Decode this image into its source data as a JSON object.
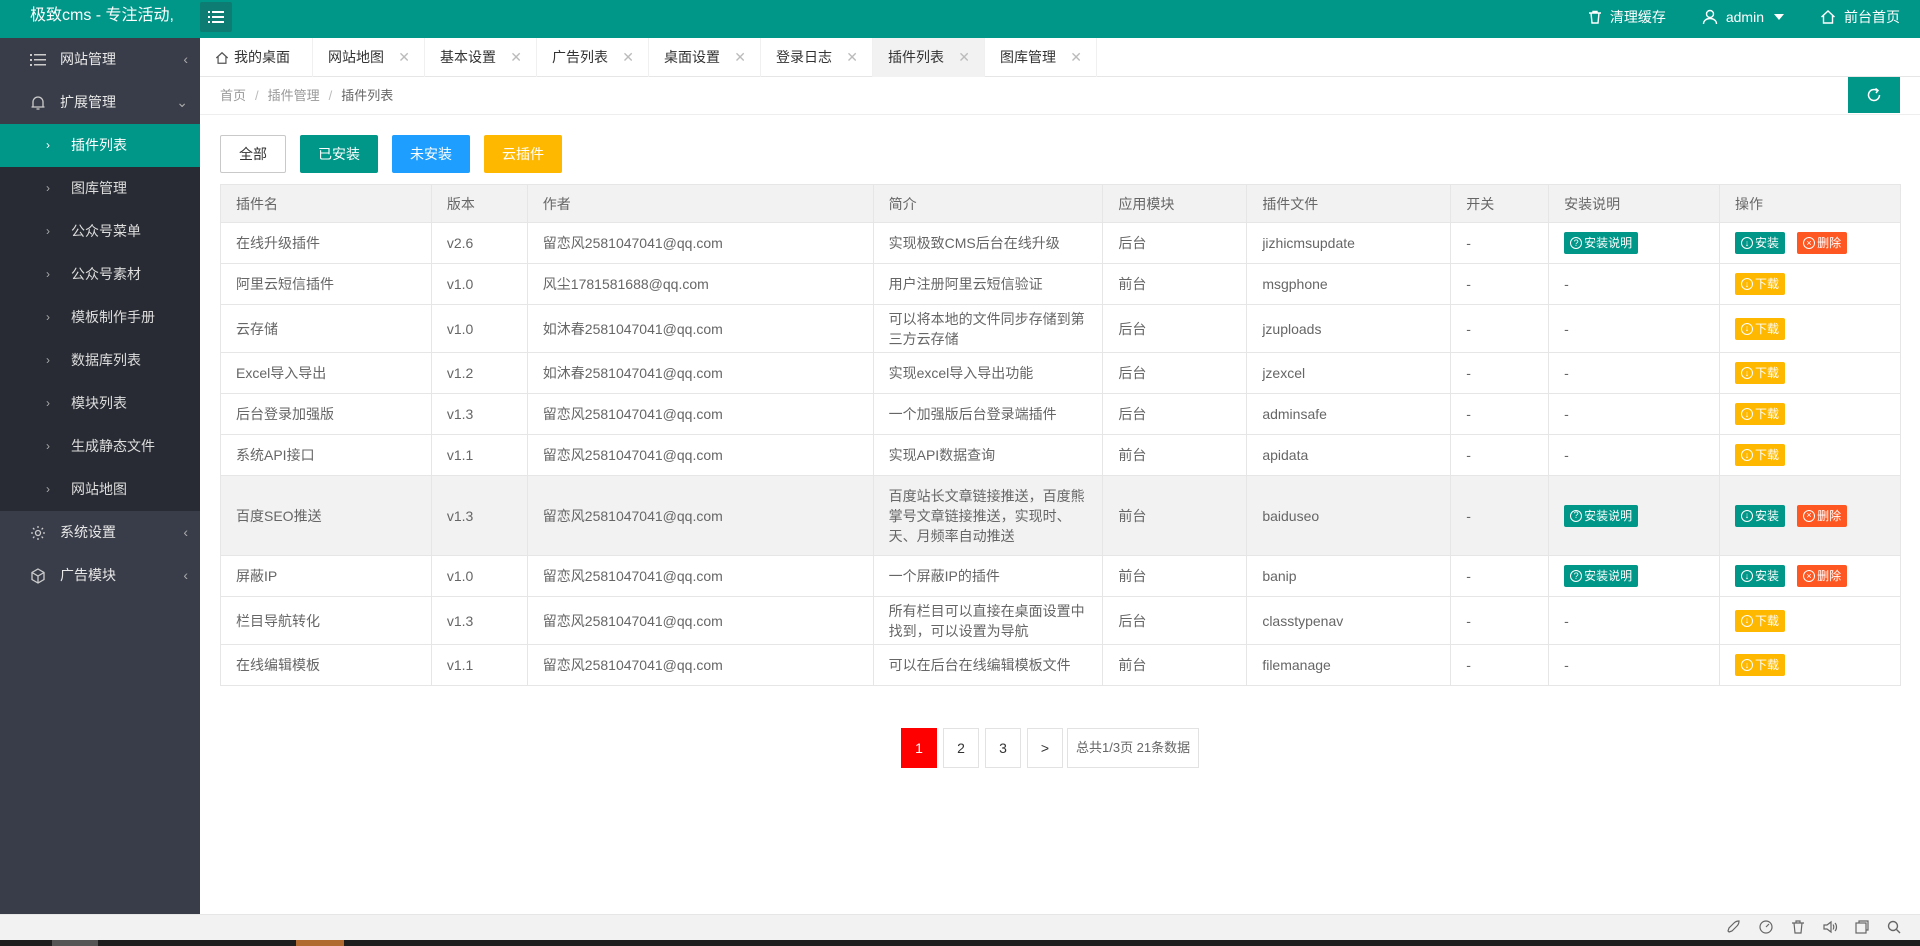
{
  "header": {
    "logo": "极致cms - 专注活动,",
    "clear_cache": "清理缓存",
    "user": "admin",
    "front_home": "前台首页"
  },
  "sidebar": {
    "site_manage": "网站管理",
    "ext_manage": "扩展管理",
    "children": [
      "插件列表",
      "图库管理",
      "公众号菜单",
      "公众号素材",
      "模板制作手册",
      "数据库列表",
      "模块列表",
      "生成静态文件",
      "网站地图"
    ],
    "sys_settings": "系统设置",
    "ad_module": "广告模块"
  },
  "tabs": [
    "我的桌面",
    "网站地图",
    "基本设置",
    "广告列表",
    "桌面设置",
    "登录日志",
    "插件列表",
    "图库管理"
  ],
  "breadcrumb": {
    "home": "首页",
    "level1": "插件管理",
    "current": "插件列表"
  },
  "filters": {
    "all": "全部",
    "installed": "已安装",
    "uninstalled": "未安装",
    "cloud": "云插件"
  },
  "table": {
    "headers": [
      "插件名",
      "版本",
      "作者",
      "简介",
      "应用模块",
      "插件文件",
      "开关",
      "安装说明",
      "操作"
    ],
    "rows": [
      {
        "name": "在线升级插件",
        "version": "v2.6",
        "author": "留恋风2581047041@qq.com",
        "desc": "实现极致CMS后台在线升级",
        "module": "后台",
        "file": "jizhicmsupdate",
        "switch": "-",
        "guide": "安装说明",
        "actions": [
          "安装",
          "删除"
        ]
      },
      {
        "name": "阿里云短信插件",
        "version": "v1.0",
        "author": "风尘1781581688@qq.com",
        "desc": "用户注册阿里云短信验证",
        "module": "前台",
        "file": "msgphone",
        "switch": "-",
        "guide": "-",
        "actions": [
          "下载"
        ]
      },
      {
        "name": "云存储",
        "version": "v1.0",
        "author": "如沐春2581047041@qq.com",
        "desc": "可以将本地的文件同步存储到第三方云存储",
        "module": "后台",
        "file": "jzuploads",
        "switch": "-",
        "guide": "-",
        "actions": [
          "下载"
        ]
      },
      {
        "name": "Excel导入导出",
        "version": "v1.2",
        "author": "如沐春2581047041@qq.com",
        "desc": "实现excel导入导出功能",
        "module": "后台",
        "file": "jzexcel",
        "switch": "-",
        "guide": "-",
        "actions": [
          "下载"
        ]
      },
      {
        "name": "后台登录加强版",
        "version": "v1.3",
        "author": "留恋风2581047041@qq.com",
        "desc": "一个加强版后台登录端插件",
        "module": "后台",
        "file": "adminsafe",
        "switch": "-",
        "guide": "-",
        "actions": [
          "下载"
        ]
      },
      {
        "name": "系统API接口",
        "version": "v1.1",
        "author": "留恋风2581047041@qq.com",
        "desc": "实现API数据查询",
        "module": "前台",
        "file": "apidata",
        "switch": "-",
        "guide": "-",
        "actions": [
          "下载"
        ]
      },
      {
        "name": "百度SEO推送",
        "version": "v1.3",
        "author": "留恋风2581047041@qq.com",
        "desc": "百度站长文章链接推送，百度熊掌号文章链接推送，实现时、天、月频率自动推送",
        "module": "前台",
        "file": "baiduseo",
        "switch": "-",
        "guide": "安装说明",
        "actions": [
          "安装",
          "删除"
        ]
      },
      {
        "name": "屏蔽IP",
        "version": "v1.0",
        "author": "留恋风2581047041@qq.com",
        "desc": "一个屏蔽IP的插件",
        "module": "前台",
        "file": "banip",
        "switch": "-",
        "guide": "安装说明",
        "actions": [
          "安装",
          "删除"
        ]
      },
      {
        "name": "栏目导航转化",
        "version": "v1.3",
        "author": "留恋风2581047041@qq.com",
        "desc": "所有栏目可以直接在桌面设置中找到，可以设置为导航",
        "module": "后台",
        "file": "classtypenav",
        "switch": "-",
        "guide": "-",
        "actions": [
          "下载"
        ]
      },
      {
        "name": "在线编辑模板",
        "version": "v1.1",
        "author": "留恋风2581047041@qq.com",
        "desc": "可以在后台在线编辑模板文件",
        "module": "前台",
        "file": "filemanage",
        "switch": "-",
        "guide": "-",
        "actions": [
          "下载"
        ]
      }
    ]
  },
  "pagination": {
    "pages": [
      "1",
      "2",
      "3"
    ],
    "next": ">",
    "info": "总共1/3页 21条数据"
  },
  "colors": {
    "primary": "#009688",
    "sidebar": "#393d49",
    "danger": "#ff5722",
    "warning": "#ffb800",
    "info": "#1e9fff"
  }
}
